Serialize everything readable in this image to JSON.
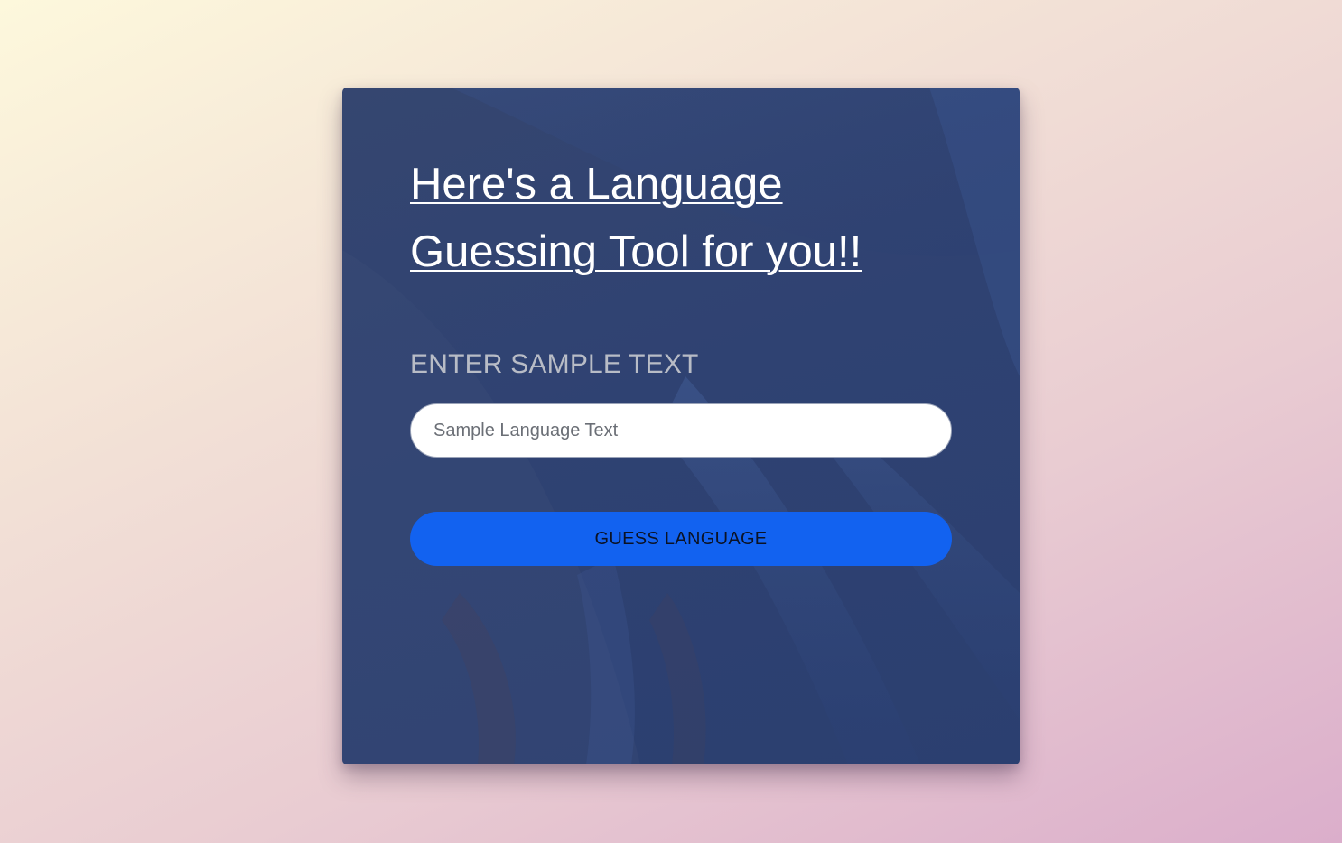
{
  "card": {
    "title": "Here's a Language Guessing Tool for you!!",
    "input_label": "ENTER SAMPLE TEXT",
    "input_placeholder": "Sample Language Text",
    "input_value": "",
    "button_label": "GUESS LANGUAGE"
  },
  "colors": {
    "card_overlay": "#2f4272",
    "button": "#1262f0",
    "title_text": "#ffffff",
    "label_text": "#b8bcc6"
  }
}
